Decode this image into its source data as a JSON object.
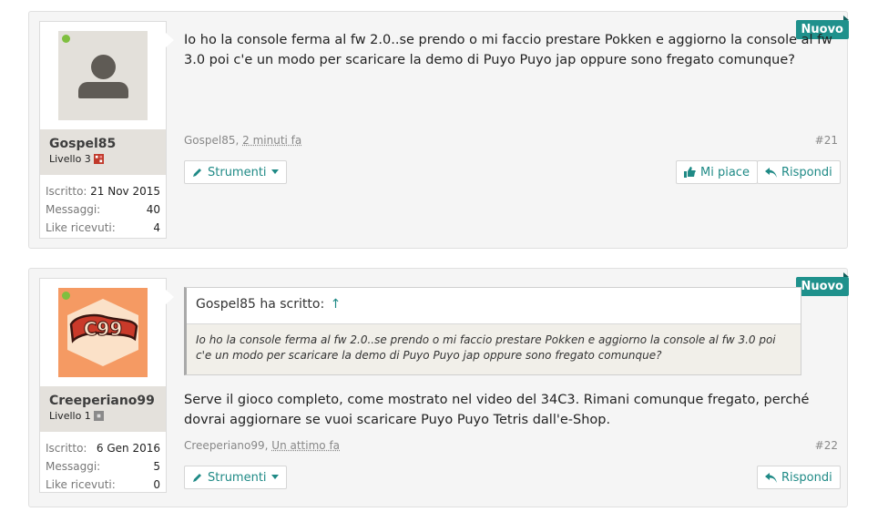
{
  "posts": [
    {
      "badge": "Nuovo",
      "user": {
        "name": "Gospel85",
        "level": "Livello 3",
        "level_color": "#c0392b",
        "avatar": "default-person-icon",
        "stats": [
          {
            "label": "Iscritto:",
            "value": "21 Nov 2015"
          },
          {
            "label": "Messaggi:",
            "value": "40"
          },
          {
            "label": "Like ricevuti:",
            "value": "4"
          }
        ]
      },
      "message": "Io ho la console ferma al fw 2.0..se prendo o mi faccio prestare Pokken e aggiorno la console al fw 3.0 poi c'e un modo per scaricare la demo di Puyo Puyo jap oppure sono fregato comunque?",
      "author": "Gospel85,",
      "time": "2 minuti fa",
      "number": "#21",
      "tools_label": "Strumenti",
      "like_label": "Mi piace",
      "reply_label": "Rispondi"
    },
    {
      "badge": "Nuovo",
      "user": {
        "name": "Creeperiano99",
        "level": "Livello 1",
        "level_color": "#888888",
        "avatar": "c99-logo-avatar",
        "stats": [
          {
            "label": "Iscritto:",
            "value": "6 Gen 2016"
          },
          {
            "label": "Messaggi:",
            "value": "5"
          },
          {
            "label": "Like ricevuti:",
            "value": "0"
          }
        ]
      },
      "quote": {
        "author": "Gospel85 ha scritto:",
        "arrow": "↑",
        "text": "Io ho la console ferma al fw 2.0..se prendo o mi faccio prestare Pokken e aggiorno la console al fw 3.0 poi c'e un modo per scaricare la demo di Puyo Puyo jap oppure sono fregato comunque?"
      },
      "message": "Serve il gioco completo, come mostrato nel video del 34C3. Rimani comunque fregato, perché dovrai aggiornare se vuoi scaricare Puyo Puyo Tetris dall'e-Shop.",
      "author": "Creeperiano99,",
      "time": "Un attimo fa",
      "number": "#22",
      "tools_label": "Strumenti",
      "reply_label": "Rispondi"
    }
  ],
  "colors": {
    "accent": "#1f918c",
    "online": "#7fbf3f"
  }
}
